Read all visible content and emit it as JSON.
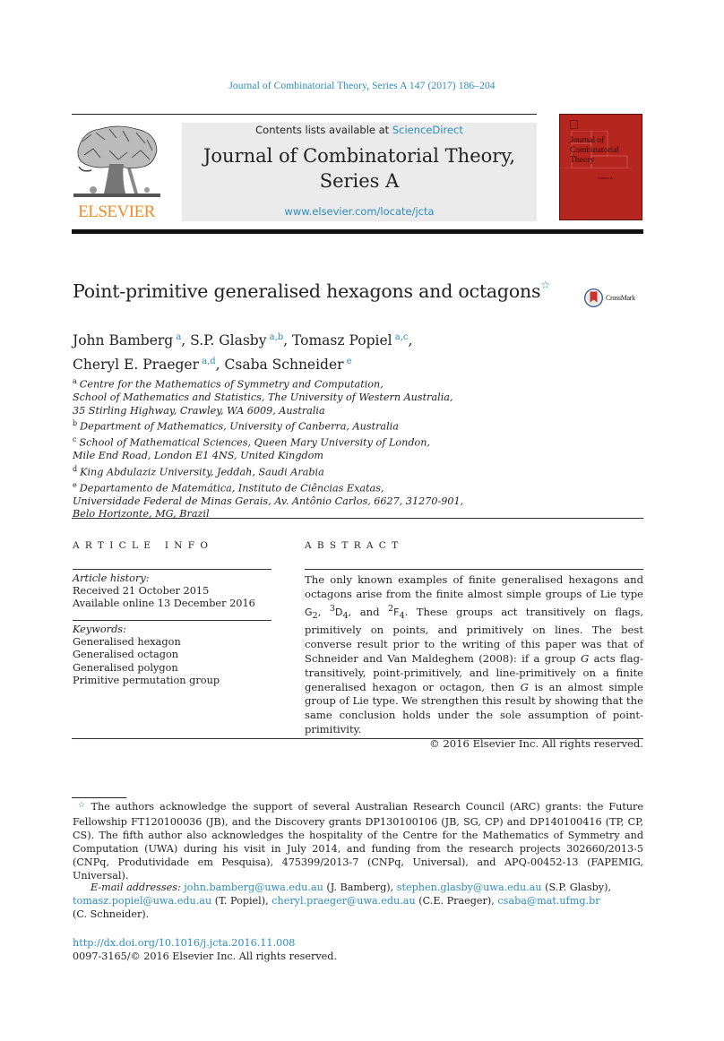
{
  "running_head": "Journal of Combinatorial Theory, Series A 147 (2017) 186–204",
  "header": {
    "publisher_logo_text": "ELSEVIER",
    "contents_prefix": "Contents lists available at ",
    "contents_link": "ScienceDirect",
    "journal_title_line1": "Journal of Combinatorial Theory,",
    "journal_title_line2": "Series A",
    "journal_url": "www.elsevier.com/locate/jcta",
    "cover": {
      "line1": "Journal of",
      "line2": "Combinatorial",
      "line3": "Theory",
      "series": "Series A",
      "color": "#b5261e"
    }
  },
  "article": {
    "title": "Point-primitive generalised hexagons and octagons",
    "title_footnote_mark": "☆",
    "crossmark_label": "CrossMark",
    "authors": [
      {
        "name": "John Bamberg",
        "affil": "a",
        "sep": ", "
      },
      {
        "name": "S.P. Glasby",
        "affil": "a,b",
        "sep": ", "
      },
      {
        "name": "Tomasz Popiel",
        "affil": "a,c",
        "sep": ","
      },
      {
        "name": "Cheryl E. Praeger",
        "affil": "a,d",
        "sep": ", "
      },
      {
        "name": "Csaba Schneider",
        "affil": "e",
        "sep": ""
      }
    ],
    "affiliations": [
      {
        "mark": "a",
        "lines": [
          "Centre for the Mathematics of Symmetry and Computation,",
          "School of Mathematics and Statistics, The University of Western Australia,",
          "35 Stirling Highway, Crawley, WA 6009, Australia"
        ]
      },
      {
        "mark": "b",
        "lines": [
          "Department of Mathematics, University of Canberra, Australia"
        ]
      },
      {
        "mark": "c",
        "lines": [
          "School of Mathematical Sciences, Queen Mary University of London,",
          "Mile End Road, London E1 4NS, United Kingdom"
        ]
      },
      {
        "mark": "d",
        "lines": [
          "King Abdulaziz University, Jeddah, Saudi Arabia"
        ]
      },
      {
        "mark": "e",
        "lines": [
          "Departamento de Matemática, Instituto de Ciências Exatas,",
          "Universidade Federal de Minas Gerais, Av. Antônio Carlos, 6627, 31270-901,",
          "Belo Horizonte, MG, Brazil"
        ]
      }
    ]
  },
  "article_info": {
    "heading": "ARTICLE INFO",
    "history_label": "Article history:",
    "received": "Received 21 October 2015",
    "available": "Available online 13 December 2016",
    "keywords_label": "Keywords:",
    "keywords": [
      "Generalised hexagon",
      "Generalised octagon",
      "Generalised polygon",
      "Primitive permutation group"
    ]
  },
  "abstract": {
    "heading": "ABSTRACT",
    "p1": "The only known examples of finite generalised hexagons and octagons arise from the finite almost simple groups of Lie type ",
    "g2": "G",
    "g2_sub": "2",
    "sep1": ", ",
    "d4_sup": "3",
    "d4": "D",
    "d4_sub": "4",
    "sep2": ", and ",
    "f4_sup": "2",
    "f4": "F",
    "f4_sub": "4",
    "p2": ". These groups act transitively on flags, primitively on points, and primitively on lines. The best converse result prior to the writing of this paper was that of Schneider and Van Maldeghem (2008): if a group ",
    "var_g": "G",
    "p3": " acts flag-transitively, point-primitively, and line-primitively on a finite generalised hexagon or octagon, then ",
    "p4": " is an almost simple group of Lie type. We strengthen this result by showing that the same conclusion holds under the sole assumption of point-primitivity.",
    "copyright": "© 2016 Elsevier Inc. All rights reserved."
  },
  "footnote": {
    "mark": "☆",
    "text": "The authors acknowledge the support of several Australian Research Council (ARC) grants: the Future Fellowship FT120100036 (JB), and the Discovery grants DP130100106 (JB, SG, CP) and DP140100416 (TP, CP, CS). The fifth author also acknowledges the hospitality of the Centre for the Mathematics of Symmetry and Computation (UWA) during his visit in July 2014, and funding from the research projects 302660/2013-5 (CNPq, Produtividade em Pesquisa), 475399/2013-7 (CNPq, Universal), and APQ-00452-13 (FAPEMIG, Universal)."
  },
  "emails": {
    "label": "E-mail addresses:",
    "items": [
      {
        "email": "john.bamberg@uwa.edu.au",
        "who": " (J. Bamberg), "
      },
      {
        "email": "stephen.glasby@uwa.edu.au",
        "who": " (S.P. Glasby), "
      },
      {
        "email": "tomasz.popiel@uwa.edu.au",
        "who": " (T. Popiel), "
      },
      {
        "email": "cheryl.praeger@uwa.edu.au",
        "who": " (C.E. Praeger), "
      },
      {
        "email": "csaba@mat.ufmg.br",
        "who": " (C. Schneider)."
      }
    ]
  },
  "doi": "http://dx.doi.org/10.1016/j.jcta.2016.11.008",
  "issn_line": "0097-3165/© 2016 Elsevier Inc. All rights reserved.",
  "colors": {
    "link": "#2d8cbc",
    "elsevier_orange": "#f08c2a",
    "header_box": "#ebebeb"
  }
}
